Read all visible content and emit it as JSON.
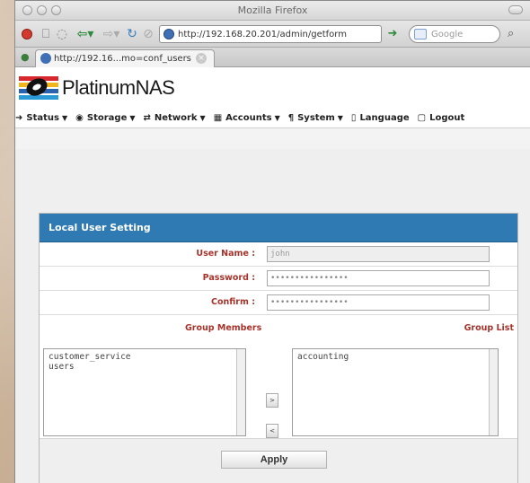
{
  "window": {
    "title": "Mozilla Firefox"
  },
  "toolbar": {
    "url": "http://192.168.20.201/admin/getform",
    "search_placeholder": "Google"
  },
  "tab": {
    "title": "http://192.16...mo=conf_users"
  },
  "app": {
    "logo_text": "PlatinumNAS"
  },
  "menu": [
    {
      "label": "Status",
      "icon": "status-icon"
    },
    {
      "label": "Storage",
      "icon": "storage-icon"
    },
    {
      "label": "Network",
      "icon": "network-icon"
    },
    {
      "label": "Accounts",
      "icon": "accounts-icon"
    },
    {
      "label": "System",
      "icon": "system-icon"
    },
    {
      "label": "Language",
      "icon": "language-icon"
    },
    {
      "label": "Logout",
      "icon": "logout-icon"
    }
  ],
  "form": {
    "title": "Local User Setting",
    "user_name_label": "User Name :",
    "user_name_value": "john",
    "password_label": "Password :",
    "password_value": "••••••••••••••••",
    "confirm_label": "Confirm :",
    "confirm_value": "••••••••••••••••",
    "group_members_label": "Group Members",
    "group_list_label": "Group List",
    "group_members": [
      "customer_service",
      "users"
    ],
    "group_list": [
      "accounting"
    ],
    "move_right_label": ">",
    "move_left_label": "<",
    "apply_label": "Apply"
  },
  "colors": {
    "header_blue": "#2f7ab3",
    "label_red": "#a8332b"
  }
}
